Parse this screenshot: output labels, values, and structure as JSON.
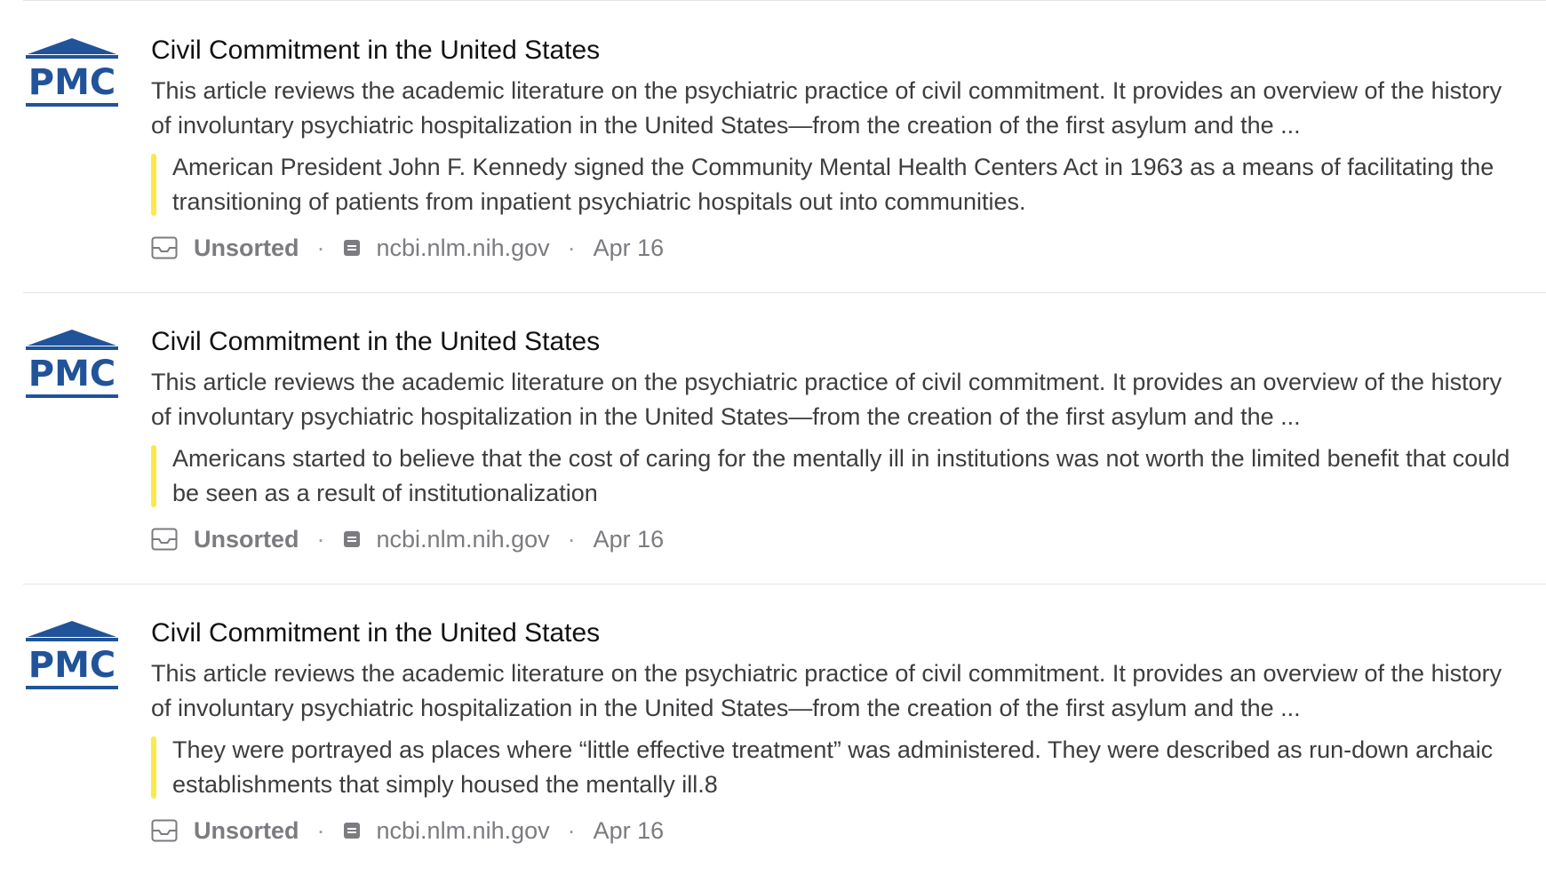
{
  "items": [
    {
      "logo_text": "PMC",
      "title": "Civil Commitment in the United States",
      "excerpt": "This article reviews the academic literature on the psychiatric practice of civil commitment. It provides an overview of the history of involuntary psychiatric hospitalization in the United States—from the creation of the first asylum and the ...",
      "highlight": "American President John F. Kennedy signed the Community Mental Health Centers Act in 1963 as a means of facilitating the transitioning of patients from inpatient psychiatric hospitals out into communities.",
      "folder": "Unsorted",
      "domain": "ncbi.nlm.nih.gov",
      "date": "Apr 16"
    },
    {
      "logo_text": "PMC",
      "title": "Civil Commitment in the United States",
      "excerpt": "This article reviews the academic literature on the psychiatric practice of civil commitment. It provides an overview of the history of involuntary psychiatric hospitalization in the United States—from the creation of the first asylum and the ...",
      "highlight": "Americans started to believe that the cost of caring for the mentally ill in institutions was not worth the limited benefit that could be seen as a result of institutionalization",
      "folder": "Unsorted",
      "domain": "ncbi.nlm.nih.gov",
      "date": "Apr 16"
    },
    {
      "logo_text": "PMC",
      "title": "Civil Commitment in the United States",
      "excerpt": "This article reviews the academic literature on the psychiatric practice of civil commitment. It provides an overview of the history of involuntary psychiatric hospitalization in the United States—from the creation of the first asylum and the ...",
      "highlight": "They were portrayed as places where “little effective treatment” was administered. They were described as run-down archaic establishments that simply housed the mentally ill.8",
      "folder": "Unsorted",
      "domain": "ncbi.nlm.nih.gov",
      "date": "Apr 16"
    }
  ],
  "meta_separator": "·",
  "icons": {
    "logo": "pmc-logo-icon",
    "folder": "inbox-tray-icon",
    "domain": "document-icon"
  },
  "colors": {
    "pmc_blue": "#20539a",
    "highlight_yellow": "#fbe94a",
    "meta_gray": "#7b7b80",
    "divider": "#e3e3e3"
  }
}
